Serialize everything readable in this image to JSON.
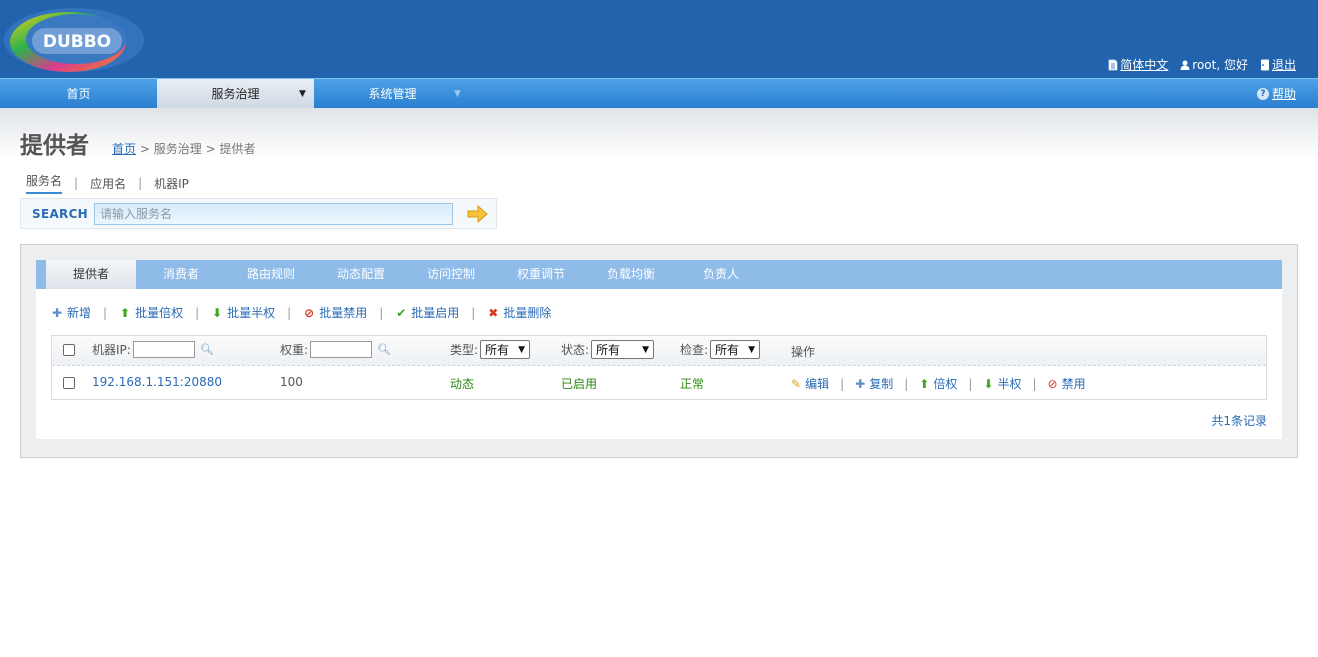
{
  "header": {
    "logo_text": "DUBBO",
    "language_link": "简体中文",
    "greeting": "root, 您好",
    "logout_link": "退出"
  },
  "nav": {
    "items": [
      {
        "label": "首页"
      },
      {
        "label": "服务治理",
        "caret": "▼"
      },
      {
        "label": "系统管理",
        "caret": "▼"
      }
    ],
    "help_label": "帮助"
  },
  "page": {
    "title": "提供者",
    "breadcrumb": {
      "home": "首页",
      "sep": ">",
      "level2": "服务治理",
      "current": "提供者"
    }
  },
  "search": {
    "tabs": [
      "服务名",
      "应用名",
      "机器IP"
    ],
    "separator": "|",
    "label": "SEARCH",
    "placeholder": "请输入服务名"
  },
  "tabs": [
    "提供者",
    "消费者",
    "路由规则",
    "动态配置",
    "访问控制",
    "权重调节",
    "负载均衡",
    "负责人"
  ],
  "toolbar": {
    "separator": "|",
    "actions": [
      {
        "label": "新增",
        "icon": "plus-icon",
        "glyph": "✚",
        "color": "#5a8fc7"
      },
      {
        "label": "批量倍权",
        "icon": "arrow-up-icon",
        "glyph": "⬆",
        "color": "#3ea61f"
      },
      {
        "label": "批量半权",
        "icon": "arrow-down-icon",
        "glyph": "⬇",
        "color": "#3ea61f"
      },
      {
        "label": "批量禁用",
        "icon": "ban-icon",
        "glyph": "⊘",
        "color": "#d9361f"
      },
      {
        "label": "批量启用",
        "icon": "check-icon",
        "glyph": "✔",
        "color": "#3ea61f"
      },
      {
        "label": "批量删除",
        "icon": "cross-icon",
        "glyph": "✖",
        "color": "#d9361f"
      }
    ]
  },
  "table": {
    "headers": {
      "ip": "机器IP:",
      "weight": "权重:",
      "type": "类型:",
      "status": "状态:",
      "check": "检查:",
      "ops": "操作"
    },
    "filters": {
      "type": "所有",
      "status": "所有",
      "check": "所有"
    },
    "rows": [
      {
        "address": "192.168.1.151:20880",
        "weight": "100",
        "type": "动态",
        "status": "已启用",
        "check": "正常",
        "ops": [
          {
            "label": "编辑",
            "icon": "pencil-icon",
            "glyph": "✎",
            "color": "#e0a020"
          },
          {
            "label": "复制",
            "icon": "plus-icon",
            "glyph": "✚",
            "color": "#5a8fc7"
          },
          {
            "label": "倍权",
            "icon": "arrow-up-icon",
            "glyph": "⬆",
            "color": "#3ea61f"
          },
          {
            "label": "半权",
            "icon": "arrow-down-icon",
            "glyph": "⬇",
            "color": "#3ea61f"
          },
          {
            "label": "禁用",
            "icon": "ban-icon",
            "glyph": "⊘",
            "color": "#d9361f"
          }
        ]
      }
    ],
    "op_separator": "|"
  },
  "footer": {
    "records": "共1条记录"
  },
  "colors": {
    "header_bg": "#2263ae",
    "nav_bg": "#3b8ad6",
    "tabbar_bg": "#8ebbe8",
    "link": "#2a6bb8",
    "green": "#2a8a12"
  }
}
